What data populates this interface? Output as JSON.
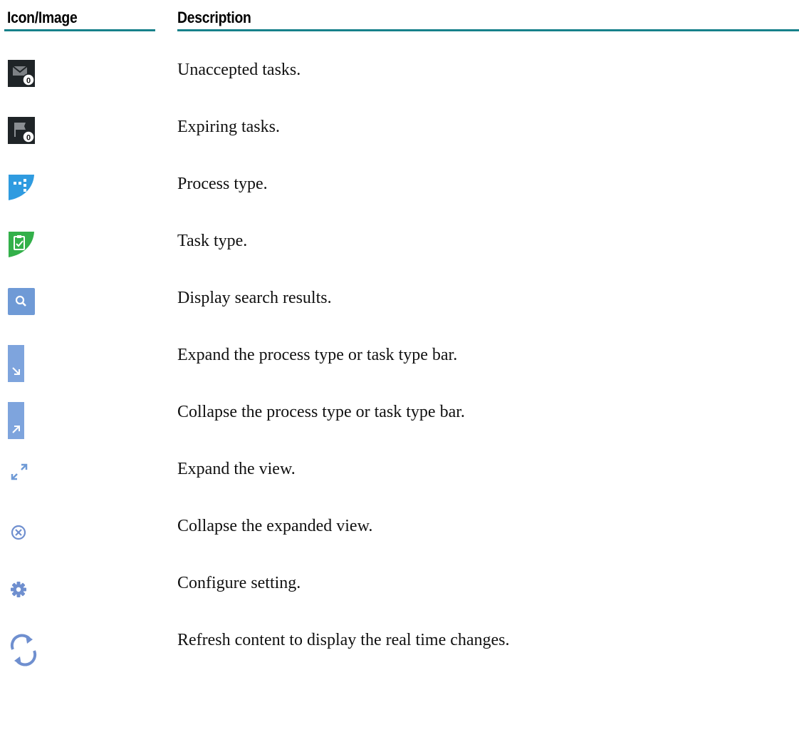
{
  "table": {
    "headers": {
      "icon": "Icon/Image",
      "description": "Description"
    },
    "header_rule_color": "#17818a",
    "rows": [
      {
        "icon": "unaccepted-tasks-icon",
        "description": "Unaccepted tasks."
      },
      {
        "icon": "expiring-tasks-icon",
        "description": "Expiring tasks."
      },
      {
        "icon": "process-type-icon",
        "description": "Process type."
      },
      {
        "icon": "task-type-icon",
        "description": "Task type."
      },
      {
        "icon": "search-icon",
        "description": "Display search results."
      },
      {
        "icon": "expand-bar-icon",
        "description": "Expand the process type or task type bar."
      },
      {
        "icon": "collapse-bar-icon",
        "description": "Collapse the process type or task type bar."
      },
      {
        "icon": "expand-view-icon",
        "description": "Expand the view."
      },
      {
        "icon": "collapse-view-icon",
        "description": "Collapse the expanded view."
      },
      {
        "icon": "gear-icon",
        "description": "Configure setting."
      },
      {
        "icon": "refresh-icon",
        "description": "Refresh content to display the real time changes."
      }
    ],
    "badge_count": "0"
  }
}
